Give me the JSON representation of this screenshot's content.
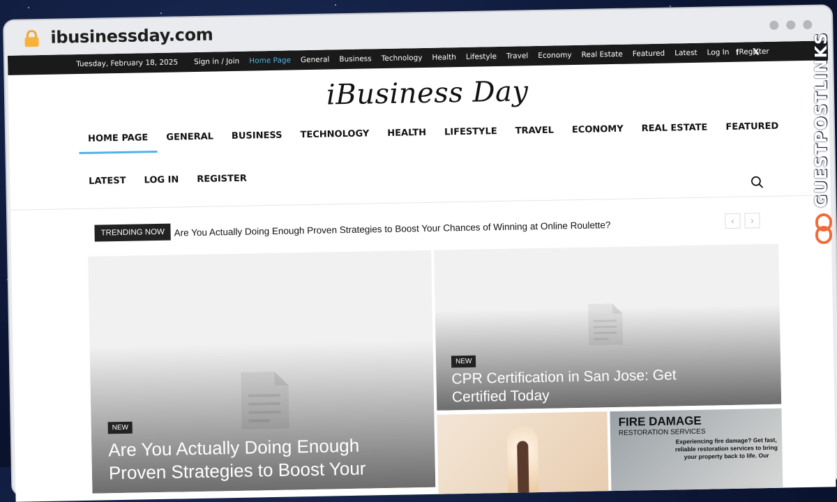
{
  "browser": {
    "url": "ibusinessday.com"
  },
  "topbar": {
    "date": "Tuesday, February 18, 2025",
    "links": [
      "Sign in / Join",
      "Home Page",
      "General",
      "Business",
      "Technology",
      "Health",
      "Lifestyle",
      "Travel",
      "Economy",
      "Real Estate",
      "Featured",
      "Latest",
      "Log In",
      "Register"
    ],
    "active_link": "Home Page",
    "social": [
      "f",
      "𝕏"
    ]
  },
  "header": {
    "logo": "iBusiness Day",
    "nav_row1": [
      "HOME PAGE",
      "GENERAL",
      "BUSINESS",
      "TECHNOLOGY",
      "HEALTH",
      "LIFESTYLE",
      "TRAVEL",
      "ECONOMY",
      "REAL ESTATE",
      "FEATURED"
    ],
    "nav_row2": [
      "LATEST",
      "LOG IN",
      "REGISTER"
    ],
    "active_nav": "HOME PAGE"
  },
  "trending": {
    "label": "TRENDING NOW",
    "headline": "Are You Actually Doing Enough Proven Strategies to Boost Your Chances of Winning at Online Roulette?",
    "prev": "‹",
    "next": "›"
  },
  "cards": [
    {
      "badge": "NEW",
      "title": "Are You Actually Doing Enough Proven Strategies to Boost Your"
    },
    {
      "badge": "NEW",
      "title": "CPR Certification in San Jose: Get Certified Today"
    },
    {
      "badge": "",
      "title": ""
    },
    {
      "badge": "",
      "title": "",
      "ad_heading": "FIRE DAMAGE",
      "ad_subheading": "RESTORATION SERVICES",
      "ad_text": "Experiencing fire damage? Get fast, reliable restoration services to bring your property back to life. Our"
    }
  ],
  "watermark": {
    "text": "GUESTPOSTLINKS"
  },
  "colors": {
    "accent": "#4db2ec",
    "topbar": "#1a1a1a",
    "watermark": "#ef6c3a"
  }
}
